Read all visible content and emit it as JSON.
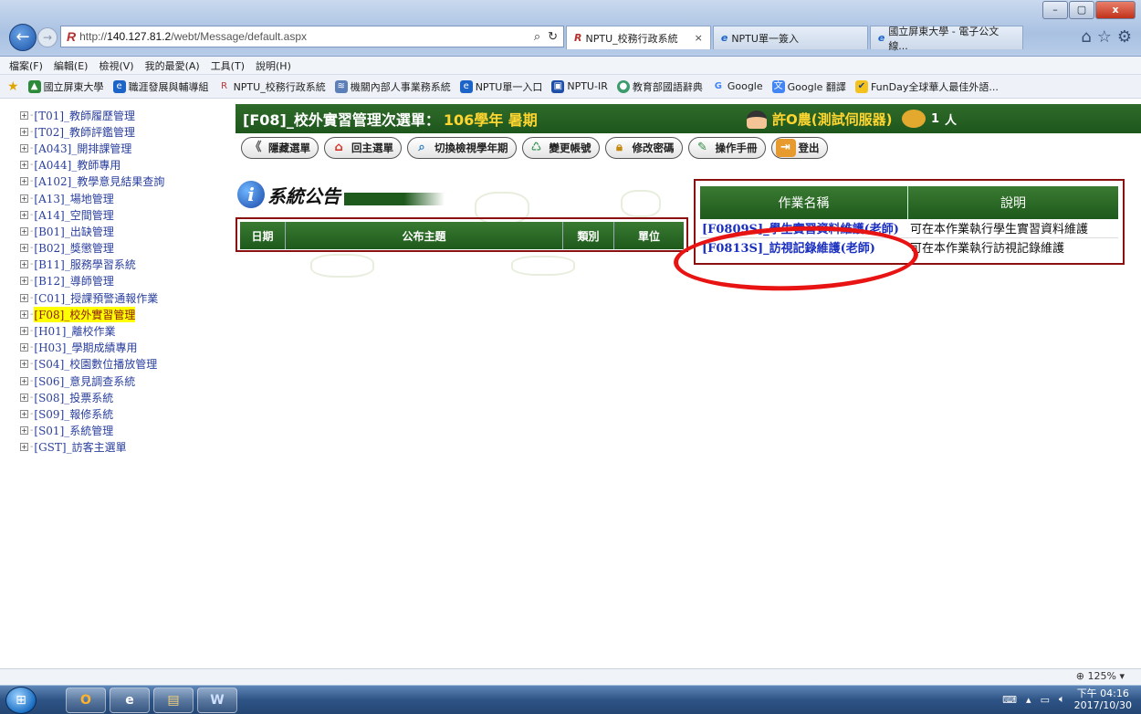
{
  "window": {
    "minimize": "–",
    "maximize": "▢",
    "close": "x"
  },
  "browser": {
    "back": "←",
    "forward": "→",
    "address_prefix": "http://",
    "address_host": "140.127.81.2",
    "address_path": "/webt/Message/default.aspx",
    "tabs": [
      {
        "label": "NPTU_校務行政系統",
        "active": true
      },
      {
        "label": "NPTU單一簽入",
        "active": false
      },
      {
        "label": "國立屏東大學 - 電子公文線...",
        "active": false
      }
    ],
    "menu": [
      "檔案(F)",
      "編輯(E)",
      "檢視(V)",
      "我的最愛(A)",
      "工具(T)",
      "說明(H)"
    ],
    "favorites": [
      "國立屏東大學",
      "職涯發展與輔導組",
      "NPTU_校務行政系統",
      "機關內部人事業務系統",
      "NPTU單一入口",
      "NPTU-IR",
      "教育部國語辭典",
      "Google",
      "Google 翻譯",
      "FunDay全球華人最佳外語..."
    ],
    "zoom": "125%"
  },
  "sidebar": {
    "items": [
      {
        "label": "[T01]_教師履歷管理",
        "active": false
      },
      {
        "label": "[T02]_教師評鑑管理",
        "active": false
      },
      {
        "label": "[A043]_開排課管理",
        "active": false
      },
      {
        "label": "[A044]_教師專用",
        "active": false
      },
      {
        "label": "[A102]_教學意見結果查詢",
        "active": false
      },
      {
        "label": "[A13]_場地管理",
        "active": false
      },
      {
        "label": "[A14]_空間管理",
        "active": false
      },
      {
        "label": "[B01]_出缺管理",
        "active": false
      },
      {
        "label": "[B02]_獎懲管理",
        "active": false
      },
      {
        "label": "[B11]_服務學習系統",
        "active": false
      },
      {
        "label": "[B12]_導師管理",
        "active": false
      },
      {
        "label": "[C01]_授課預警通報作業",
        "active": false
      },
      {
        "label": "[F08]_校外實習管理",
        "active": true
      },
      {
        "label": "[H01]_離校作業",
        "active": false
      },
      {
        "label": "[H03]_學期成績專用",
        "active": false
      },
      {
        "label": "[S04]_校園數位播放管理",
        "active": false
      },
      {
        "label": "[S06]_意見調查系統",
        "active": false
      },
      {
        "label": "[S08]_投票系統",
        "active": false
      },
      {
        "label": "[S09]_報修系統",
        "active": false
      },
      {
        "label": "[S01]_系統管理",
        "active": false
      },
      {
        "label": "[GST]_訪客主選單",
        "active": false
      }
    ]
  },
  "header": {
    "title": "[F08]_校外實習管理次選單：",
    "semester": "106學年 暑期",
    "user": "許O農(測試伺服器)",
    "online_count": "1",
    "online_unit": "人"
  },
  "toolbar": {
    "buttons": [
      "隱藏選單",
      "回主選單",
      "切換檢視學年期",
      "變更帳號",
      "修改密碼",
      "操作手冊",
      "登出"
    ]
  },
  "announcement": {
    "title_text": "系統公告",
    "columns": [
      "日期",
      "公布主題",
      "類別",
      "單位"
    ]
  },
  "operations": {
    "columns": [
      "作業名稱",
      "說明"
    ],
    "rows": [
      {
        "name": "[F0809S]_學生實習資料維護(老師)",
        "desc": "可在本作業執行學生實習資料維護"
      },
      {
        "name": "[F0813S]_訪視記錄維護(老師)",
        "desc": "可在本作業執行訪視記錄維護"
      }
    ]
  },
  "taskbar": {
    "clock_time": "下午 04:16",
    "clock_date": "2017/10/30"
  }
}
